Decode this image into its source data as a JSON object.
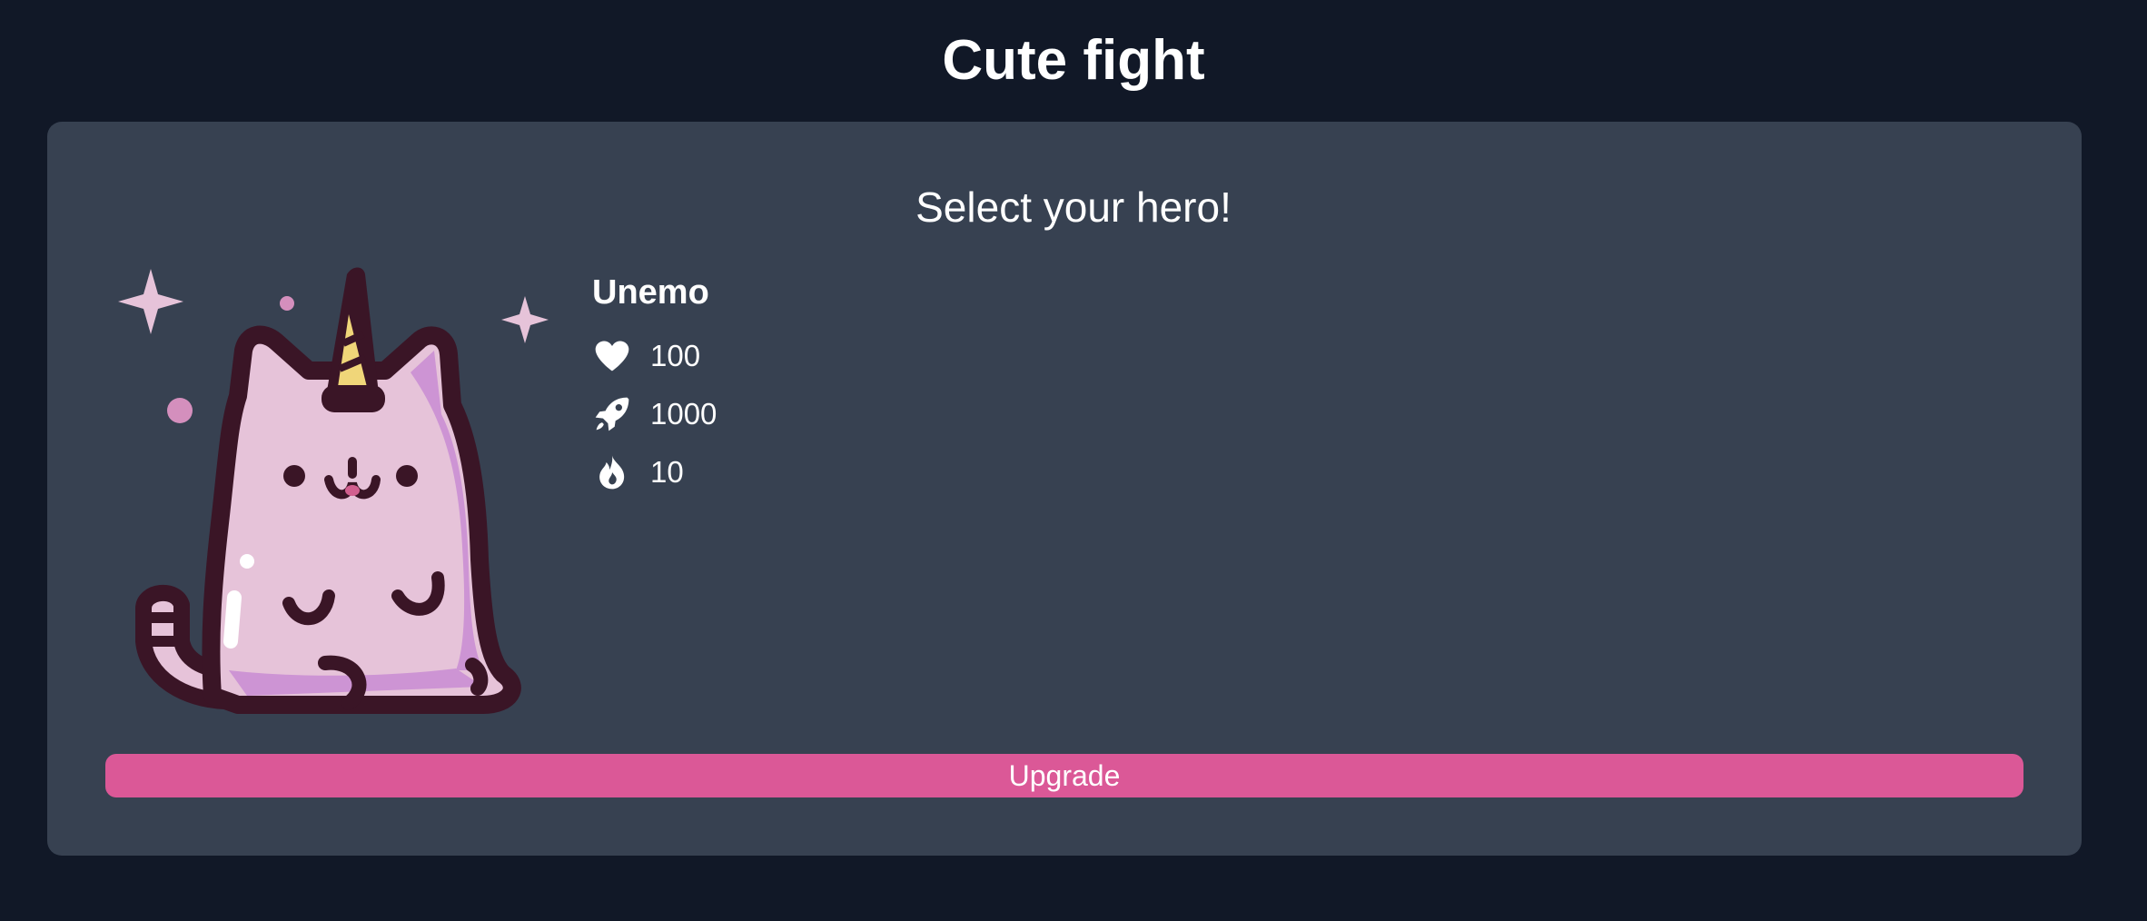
{
  "app": {
    "title": "Cute fight"
  },
  "hero_select": {
    "heading": "Select your hero!",
    "hero": {
      "name": "Unemo",
      "illustration": "unicorn-cat-illustration",
      "stats": [
        {
          "icon": "heart-icon",
          "value": "100"
        },
        {
          "icon": "rocket-icon",
          "value": "1000"
        },
        {
          "icon": "fire-icon",
          "value": "10"
        }
      ]
    },
    "upgrade_label": "Upgrade"
  },
  "colors": {
    "background": "#111827",
    "card": "#374151",
    "accent": "#db5897",
    "cat_body": "#e6c3d9",
    "cat_shade": "#cd94d4",
    "outline": "#3a1526",
    "horn": "#f0d679"
  }
}
